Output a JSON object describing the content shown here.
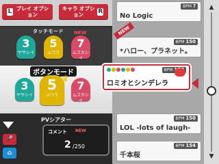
{
  "options": {
    "play_key": "L",
    "play_label": "プレイ オプション",
    "char_key": "R",
    "char_label": "キャラ オプション"
  },
  "touch_mode": {
    "label": "タッチモード",
    "difficulties": [
      {
        "level": "3",
        "name": "ヤサシイ"
      },
      {
        "level": "5",
        "name": "ふつう"
      },
      {
        "level": "7",
        "name": "ムズカシイ",
        "new": "NEW"
      }
    ]
  },
  "button_mode": {
    "label": "ボタンモード",
    "difficulties": [
      {
        "level": "3",
        "name": "ヤサシイ"
      },
      {
        "level": "5",
        "name": "ふつう"
      },
      {
        "level": "7",
        "name": "ムズカシイ"
      }
    ]
  },
  "pv_theater": {
    "label": "PVシアター",
    "comment_label": "コメント",
    "comment_new": "NEW",
    "comment_count": "2",
    "comment_total": "/250"
  },
  "songs": [
    {
      "title": "No Logic",
      "bpm": "?"
    },
    {
      "title": "*ハロー、プラネット。",
      "bpm": "150",
      "new": "NEW"
    },
    {
      "title": "ロミオとシンデレラ",
      "bpm": "170",
      "bpm_label": "BPM",
      "selected": true
    },
    {
      "title": "LOL -lots of laugh-",
      "bpm": "150"
    },
    {
      "title": "千本桜",
      "bpm": "154"
    }
  ],
  "colors": {
    "accent": "#c82a3a",
    "teal": "#1fa79a",
    "yellow": "#e0b500",
    "pink": "#d84a66"
  }
}
